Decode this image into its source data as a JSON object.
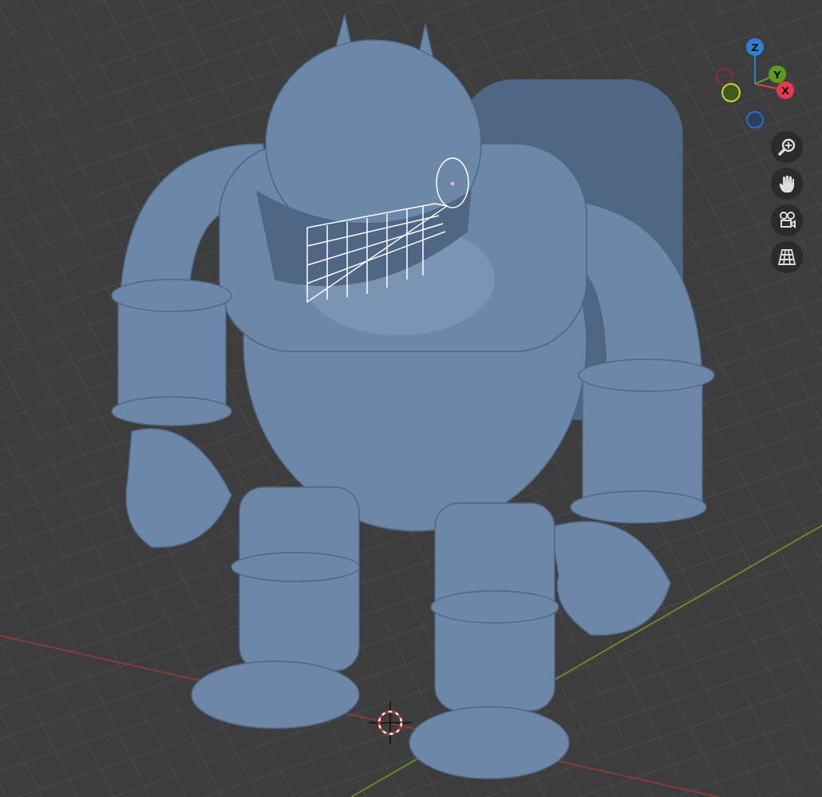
{
  "viewport": {
    "gizmo_axes": [
      {
        "label": "Z",
        "color": "#2f7fd6"
      },
      {
        "label": "Y",
        "color": "#5e9a1e"
      },
      {
        "label": "X",
        "color": "#e8384f"
      }
    ]
  }
}
